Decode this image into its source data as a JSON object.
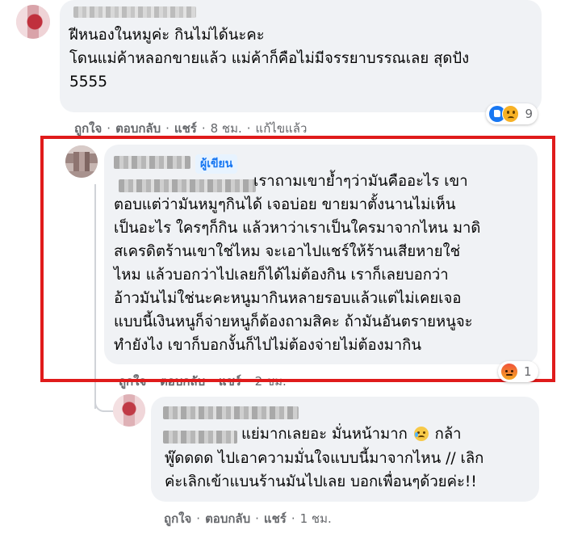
{
  "comments": [
    {
      "lines": [
        "ฝีหนองในหมูค่ะ กินไม่ได้นะคะ",
        "โดนแม่ค้าหลอกขายแล้ว แม่ค้าก็คือไม่มีจรรยาบรรณเลย สุดปัง",
        "5555"
      ],
      "actions": {
        "like": "ถูกใจ",
        "reply": "ตอบกลับ",
        "share": "แชร์",
        "time": "8 ชม.",
        "edited": "แก้ไขแล้ว"
      },
      "reactions": {
        "icons": [
          "like-icon",
          "sad-icon"
        ],
        "count": "9"
      }
    },
    {
      "author_badge": "ผู้เขียน",
      "lines": [
        "เราถามเขาย้ำๆว่ามันคืออะไร เขา",
        "ตอบแต่ว่ามันหมูๆกินได้ เจอบ่อย ขายมาตั้งนานไม่เห็น",
        "เป็นอะไร ใครๆก็กิน แล้วหาว่าเราเป็นใครมาจากไหน มาดิ",
        "สเครดิตร้านเขาใช่ไหม จะเอาไปแชร์ให้ร้านเสียหายใช่",
        "ไหม แล้วบอกว่าไปเลยก็ได้ไม่ต้องกิน เราก็เลยบอกว่า",
        "อ้าวมันไม่ใช่นะคะหนูมากินหลายรอบแล้วแต่ไม่เคยเจอ",
        "แบบนี้เงินหนูก็จ่ายหนูก็ต้องถามสิคะ ถ้ามันอันตรายหนูจะ",
        "ทำยังไง เขาก็บอกงั้นก็ไปไม่ต้องจ่ายไม่ต้องมากิน"
      ],
      "actions": {
        "like": "ถูกใจ",
        "reply": "ตอบกลับ",
        "share": "แชร์",
        "time": "2 ชม."
      },
      "reactions": {
        "icons": [
          "angry-icon"
        ],
        "count": "1"
      }
    },
    {
      "lines_a": [
        "แย่มากเลยอะ มั่นหน้ามาก",
        "กล้า"
      ],
      "lines": [
        "พู๊ดดดด ไปเอาความมั่นใจแบบนี้มาจากไหน // เลิก",
        "ค่ะเลิกเข้าแบนร้านมันไปเลย บอกเพื่อนๆด้วยค่ะ!!"
      ],
      "actions": {
        "like": "ถูกใจ",
        "reply": "ตอบกลับ",
        "share": "แชร์",
        "time": "1 ชม."
      }
    }
  ],
  "colors": {
    "highlight": "#e01b1b",
    "bubble": "#f0f2f5",
    "meta": "#65676b",
    "badge": "#1877f2"
  }
}
